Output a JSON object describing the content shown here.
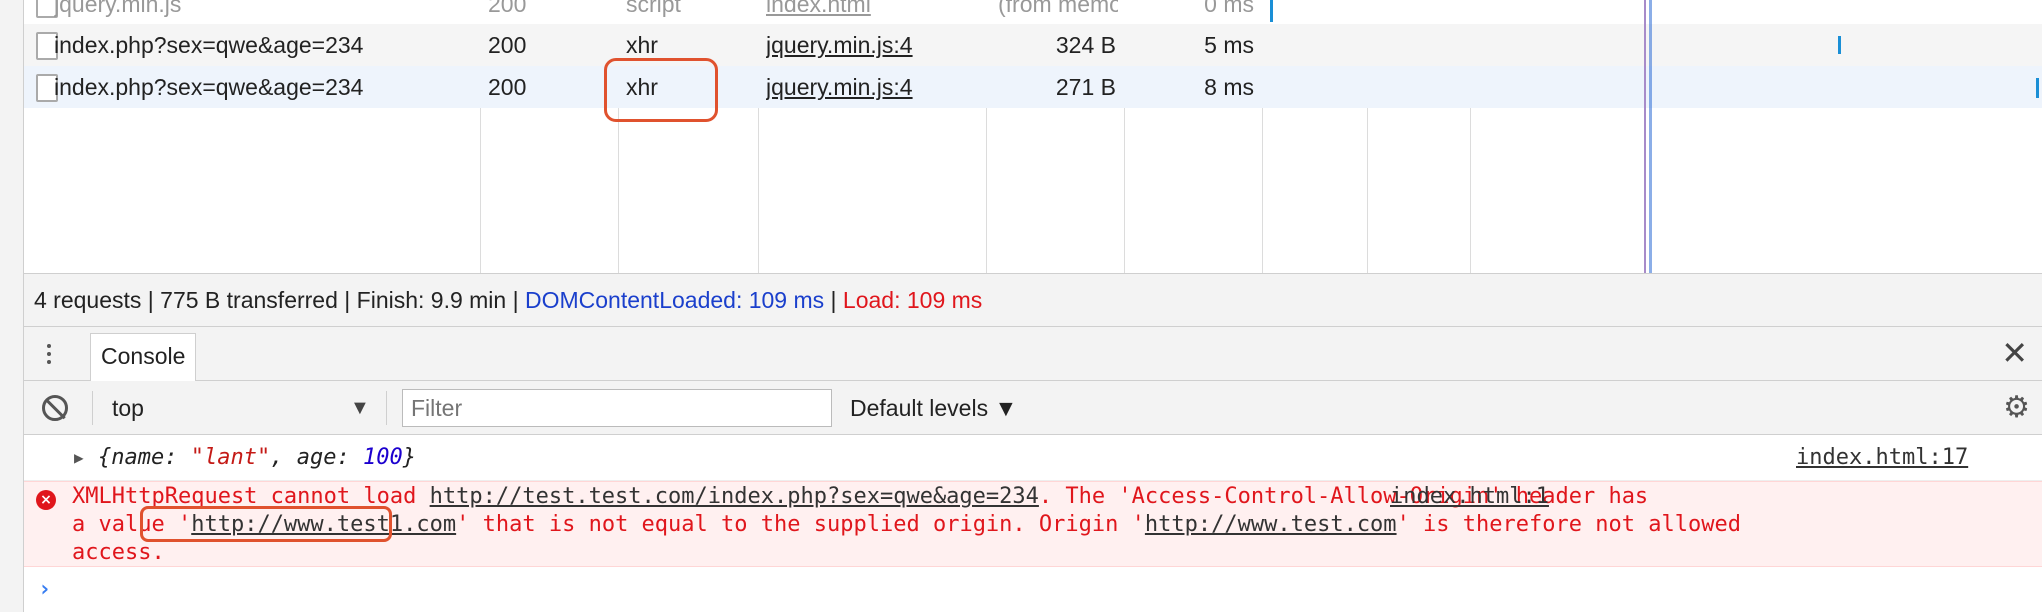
{
  "network": {
    "rows": [
      {
        "name": "jquery.min.js",
        "status": "200",
        "type": "script",
        "initiator": "index.html",
        "size": "(from memo…",
        "time": "0 ms"
      },
      {
        "name": "index.php?sex=qwe&age=234",
        "status": "200",
        "type": "xhr",
        "initiator": "jquery.min.js:4",
        "size": "324 B",
        "time": "5 ms"
      },
      {
        "name": "index.php?sex=qwe&age=234",
        "status": "200",
        "type": "xhr",
        "initiator": "jquery.min.js:4",
        "size": "271 B",
        "time": "8 ms"
      }
    ],
    "summary": {
      "requests": "4 requests",
      "transferred": "775 B transferred",
      "finish": "Finish: 9.9 min",
      "dom_content_loaded": "DOMContentLoaded: 109 ms",
      "load": "Load: 109 ms",
      "separator": " | "
    }
  },
  "drawer": {
    "tab": "Console",
    "close_glyph": "✕"
  },
  "toolbar": {
    "context": "top",
    "context_arrow": "▼",
    "filter_placeholder": "Filter",
    "levels": "Default levels ▼",
    "gear_glyph": "⚙"
  },
  "console": {
    "log": {
      "open": "{",
      "k1": "name",
      "v1": "\"lant\"",
      "k2": "age",
      "v2": "100",
      "close": "}",
      "source": "index.html:17"
    },
    "error": {
      "line1_text": "XMLHttpRequest cannot load ",
      "line1_url": "http://test.test.com/index.php?sex=qwe&age=234",
      "line1_rest": ". The 'Access-Control-Allow-Origin' header has",
      "source": "index.html:1",
      "line2_a": "a value ",
      "line2_q1": "'",
      "line2_url": "http://www.test1.com",
      "line2_q2": "'",
      "line2_b": " that is not equal to the supplied origin. Origin '",
      "line2_origin": "http://www.test.com",
      "line2_c": "' is therefore not allowed",
      "line3": "access."
    },
    "prompt": "›"
  },
  "colors": {
    "error_red": "#e0161c",
    "highlight": "#e0522e",
    "dom_blue": "#1a3fcc"
  }
}
